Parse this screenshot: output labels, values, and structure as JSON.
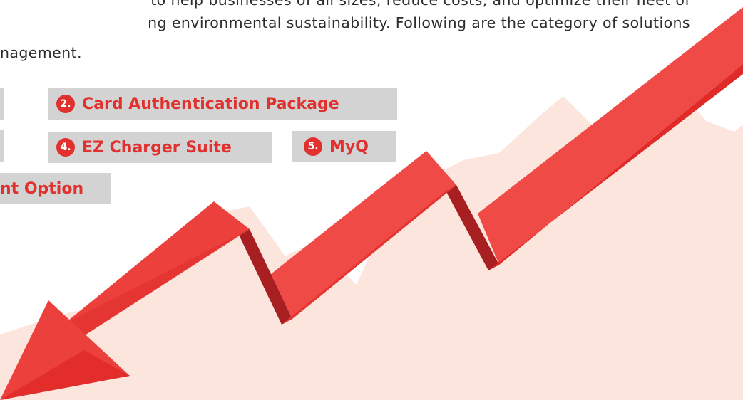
{
  "intro": {
    "line1": "to help businesses of all sizes, reduce costs, and optimize their fleet of",
    "line2": "ng environmental sustainability. Following are the category of solutions",
    "line3": "nagement."
  },
  "options": [
    {
      "number": "2.",
      "label": "Card Authentication Package"
    },
    {
      "number": "4.",
      "label": "EZ Charger Suite"
    },
    {
      "number": "5.",
      "label": "MyQ"
    },
    {
      "label": "nt Option"
    }
  ],
  "colors": {
    "accent": "#e0312f",
    "pill_bg": "#d3d3d3",
    "mountain": "#fce5dd",
    "arrow_light": "#ef4a45",
    "arrow_dark": "#a81f22"
  }
}
